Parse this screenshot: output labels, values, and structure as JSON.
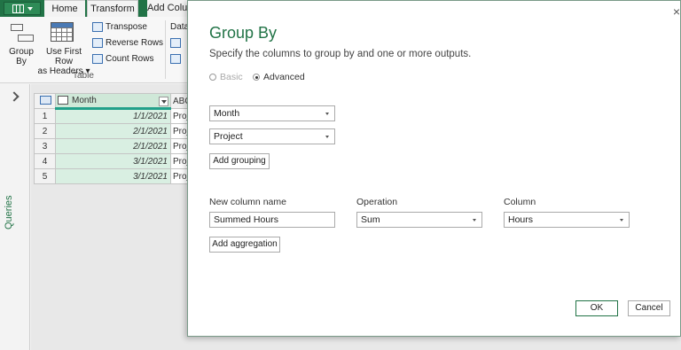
{
  "ribbon": {
    "tabs": [
      "Home",
      "Transform",
      "Add Colu"
    ],
    "group_by_label_1": "Group",
    "group_by_label_2": "By",
    "first_row_label_1": "Use First Row",
    "first_row_label_2": "as Headers",
    "first_row_caret": "▾",
    "transpose": "Transpose",
    "reverse_rows": "Reverse Rows",
    "count_rows": "Count Rows",
    "table_group": "Table",
    "data_cut": "Data"
  },
  "rail": {
    "queries_label": "Queries"
  },
  "grid": {
    "col_month": "Month",
    "col_project_type": "ABC",
    "rows": [
      {
        "n": "1",
        "month": "1/1/2021",
        "project": "Proj"
      },
      {
        "n": "2",
        "month": "2/1/2021",
        "project": "Proj"
      },
      {
        "n": "3",
        "month": "2/1/2021",
        "project": "Proj"
      },
      {
        "n": "4",
        "month": "3/1/2021",
        "project": "Proj"
      },
      {
        "n": "5",
        "month": "3/1/2021",
        "project": "Proj"
      }
    ]
  },
  "dialog": {
    "close": "×",
    "title": "Group By",
    "subtitle": "Specify the columns to group by and one or more outputs.",
    "radio_basic": "Basic",
    "radio_advanced": "Advanced",
    "group1": "Month",
    "group2": "Project",
    "add_grouping": "Add grouping",
    "hdr_new_col": "New column name",
    "hdr_operation": "Operation",
    "hdr_column": "Column",
    "new_col_value": "Summed Hours",
    "operation_value": "Sum",
    "column_value": "Hours",
    "add_aggregation": "Add aggregation",
    "ok": "OK",
    "cancel": "Cancel"
  }
}
